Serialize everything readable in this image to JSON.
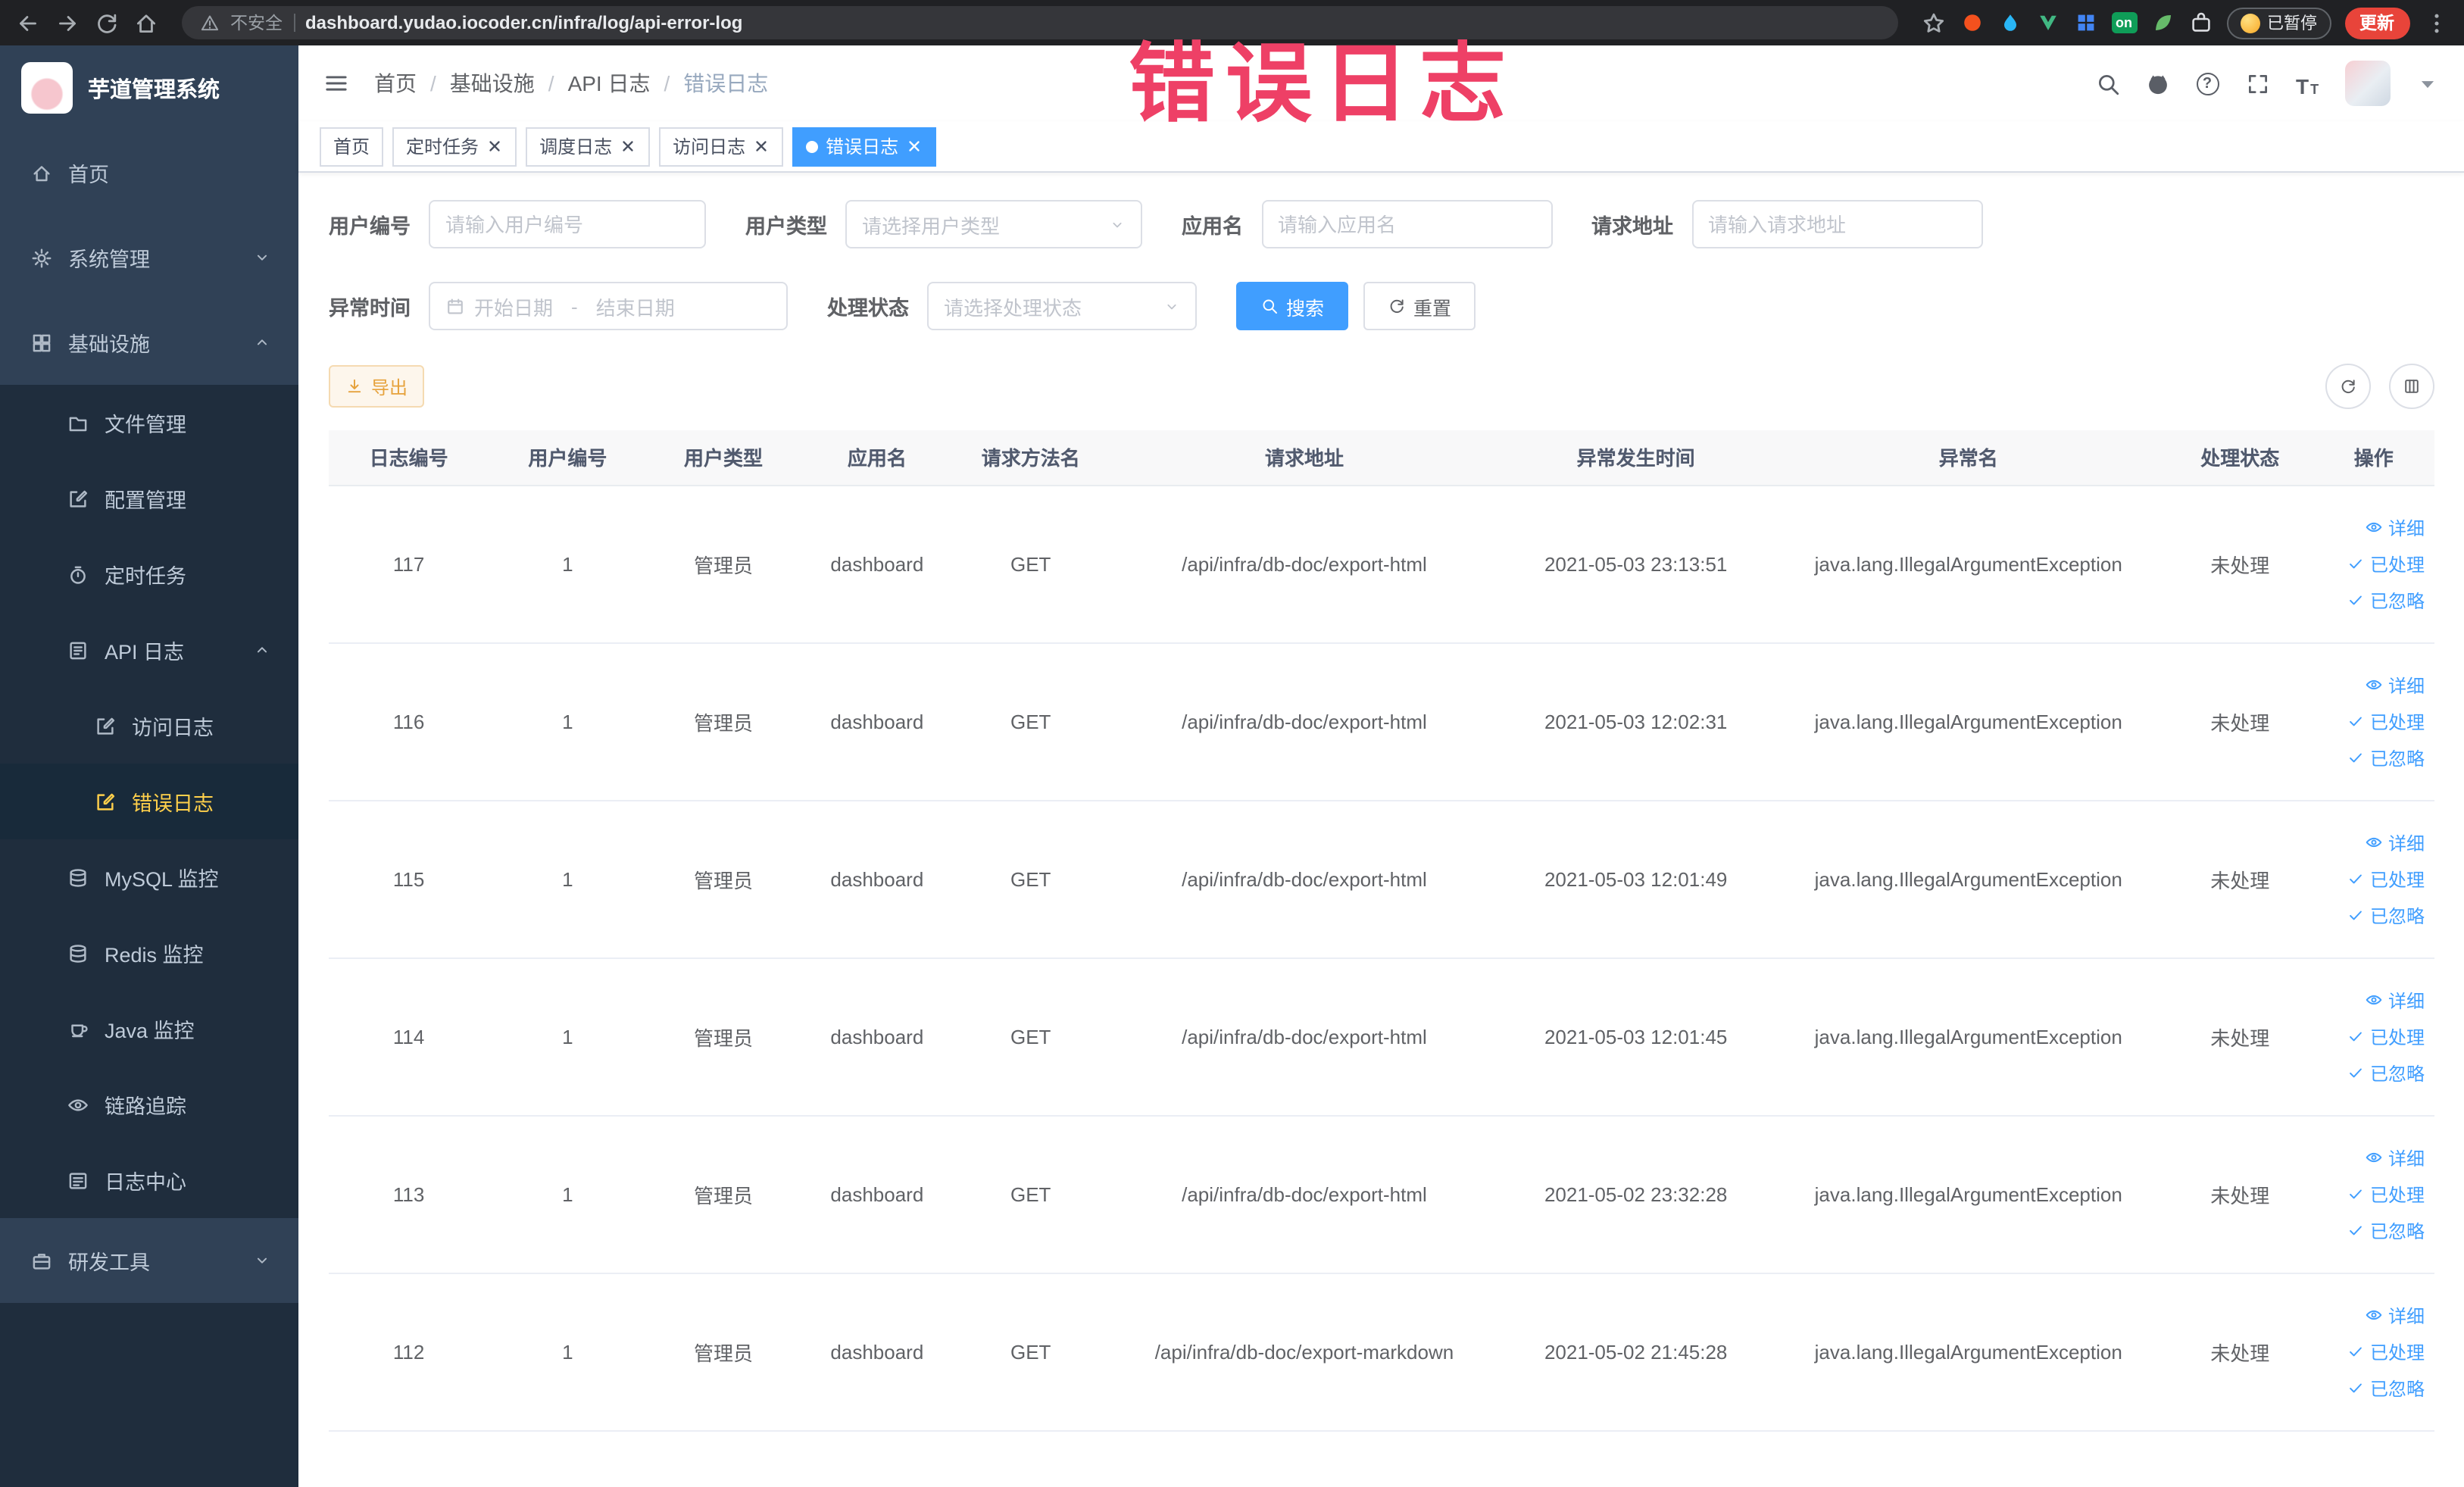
{
  "colors": {
    "primary": "#409EFF",
    "menu_active": "#ffd04b",
    "annotation": "#ee4066",
    "update": "#e8443a"
  },
  "annotation": {
    "text": "错误日志"
  },
  "browser": {
    "security_label": "不安全",
    "url": "dashboard.yudao.iocoder.cn/infra/log/api-error-log",
    "paused_label": "已暂停",
    "update_label": "更新",
    "extensions": [
      {
        "key": "ball",
        "icon": "ball",
        "color": "orange"
      },
      {
        "key": "drop",
        "icon": "drop",
        "color": "lightblue"
      },
      {
        "key": "vue",
        "icon": "vue",
        "color": "green"
      },
      {
        "key": "grid",
        "icon": "grid4",
        "color": "blue"
      },
      {
        "key": "on",
        "badge": "on"
      },
      {
        "key": "leaf",
        "icon": "leaf",
        "color": "midgreen"
      },
      {
        "key": "puzzle",
        "icon": "puzzle",
        "color": "lightgray"
      }
    ]
  },
  "sidebar": {
    "logo_title": "芋道管理系统",
    "items": [
      {
        "key": "home",
        "label": "首页",
        "icon": "home",
        "level": 1
      },
      {
        "key": "system",
        "label": "系统管理",
        "icon": "gear",
        "level": 1,
        "chevron": "down"
      },
      {
        "key": "infra",
        "label": "基础设施",
        "icon": "infra",
        "level": 1,
        "chevron": "up"
      },
      {
        "key": "file",
        "label": "文件管理",
        "icon": "folder",
        "level": 2
      },
      {
        "key": "config",
        "label": "配置管理",
        "icon": "editdoc",
        "level": 2
      },
      {
        "key": "job",
        "label": "定时任务",
        "icon": "timer",
        "level": 2
      },
      {
        "key": "api-log",
        "label": "API 日志",
        "icon": "apilog",
        "level": 2,
        "chevron": "up"
      },
      {
        "key": "access-log",
        "label": "访问日志",
        "icon": "editdoc",
        "level": 3
      },
      {
        "key": "error-log",
        "label": "错误日志",
        "icon": "editdoc",
        "level": 3,
        "active": true
      },
      {
        "key": "mysql",
        "label": "MySQL 监控",
        "icon": "db",
        "level": 2
      },
      {
        "key": "redis",
        "label": "Redis 监控",
        "icon": "db",
        "level": 2
      },
      {
        "key": "java",
        "label": "Java 监控",
        "icon": "cup",
        "level": 2
      },
      {
        "key": "trace",
        "label": "链路追踪",
        "icon": "eye",
        "level": 2
      },
      {
        "key": "log-center",
        "label": "日志中心",
        "icon": "logcenter",
        "level": 2
      },
      {
        "key": "dev-tools",
        "label": "研发工具",
        "icon": "tool",
        "level": 1,
        "chevron": "down"
      }
    ]
  },
  "header": {
    "breadcrumb": [
      "首页",
      "基础设施",
      "API 日志",
      "错误日志"
    ]
  },
  "tabs": [
    {
      "key": "home",
      "label": "首页",
      "closable": false,
      "active": false
    },
    {
      "key": "job",
      "label": "定时任务",
      "closable": true,
      "active": false
    },
    {
      "key": "job-log",
      "label": "调度日志",
      "closable": true,
      "active": false
    },
    {
      "key": "access-log",
      "label": "访问日志",
      "closable": true,
      "active": false
    },
    {
      "key": "error-log",
      "label": "错误日志",
      "closable": true,
      "active": true
    }
  ],
  "filters": {
    "user_id": {
      "label": "用户编号",
      "placeholder": "请输入用户编号"
    },
    "user_type": {
      "label": "用户类型",
      "placeholder": "请选择用户类型"
    },
    "app_name": {
      "label": "应用名",
      "placeholder": "请输入应用名"
    },
    "request_url": {
      "label": "请求地址",
      "placeholder": "请输入请求地址"
    },
    "exception_time": {
      "label": "异常时间",
      "start_placeholder": "开始日期",
      "separator": "-",
      "end_placeholder": "结束日期"
    },
    "process_status": {
      "label": "处理状态",
      "placeholder": "请选择处理状态"
    },
    "search_label": "搜索",
    "reset_label": "重置"
  },
  "toolbar": {
    "export_label": "导出"
  },
  "table": {
    "columns": [
      {
        "key": "id",
        "label": "日志编号",
        "width": 7.6
      },
      {
        "key": "user_id",
        "label": "用户编号",
        "width": 7.5
      },
      {
        "key": "user_type",
        "label": "用户类型",
        "width": 7.3
      },
      {
        "key": "app",
        "label": "应用名",
        "width": 7.3
      },
      {
        "key": "method",
        "label": "请求方法名",
        "width": 7.3
      },
      {
        "key": "url",
        "label": "请求地址",
        "width": 18.7
      },
      {
        "key": "time",
        "label": "异常发生时间",
        "width": 12.8
      },
      {
        "key": "exception",
        "label": "异常名",
        "width": 18.8
      },
      {
        "key": "status",
        "label": "处理状态",
        "width": 7.0
      },
      {
        "key": "_actions",
        "label": "操作",
        "width": 5.7
      }
    ],
    "actions": [
      {
        "key": "detail",
        "label": "详细",
        "icon": "eye"
      },
      {
        "key": "processed",
        "label": "已处理",
        "icon": "check"
      },
      {
        "key": "ignored",
        "label": "已忽略",
        "icon": "check"
      }
    ],
    "rows": [
      {
        "id": "117",
        "user_id": "1",
        "user_type": "管理员",
        "app": "dashboard",
        "method": "GET",
        "url": "/api/infra/db-doc/export-html",
        "time": "2021-05-03 23:13:51",
        "exception": "java.lang.IllegalArgumentException",
        "status": "未处理"
      },
      {
        "id": "116",
        "user_id": "1",
        "user_type": "管理员",
        "app": "dashboard",
        "method": "GET",
        "url": "/api/infra/db-doc/export-html",
        "time": "2021-05-03 12:02:31",
        "exception": "java.lang.IllegalArgumentException",
        "status": "未处理"
      },
      {
        "id": "115",
        "user_id": "1",
        "user_type": "管理员",
        "app": "dashboard",
        "method": "GET",
        "url": "/api/infra/db-doc/export-html",
        "time": "2021-05-03 12:01:49",
        "exception": "java.lang.IllegalArgumentException",
        "status": "未处理"
      },
      {
        "id": "114",
        "user_id": "1",
        "user_type": "管理员",
        "app": "dashboard",
        "method": "GET",
        "url": "/api/infra/db-doc/export-html",
        "time": "2021-05-03 12:01:45",
        "exception": "java.lang.IllegalArgumentException",
        "status": "未处理"
      },
      {
        "id": "113",
        "user_id": "1",
        "user_type": "管理员",
        "app": "dashboard",
        "method": "GET",
        "url": "/api/infra/db-doc/export-html",
        "time": "2021-05-02 23:32:28",
        "exception": "java.lang.IllegalArgumentException",
        "status": "未处理"
      },
      {
        "id": "112",
        "user_id": "1",
        "user_type": "管理员",
        "app": "dashboard",
        "method": "GET",
        "url": "/api/infra/db-doc/export-markdown",
        "time": "2021-05-02 21:45:28",
        "exception": "java.lang.IllegalArgumentException",
        "status": "未处理"
      }
    ]
  }
}
